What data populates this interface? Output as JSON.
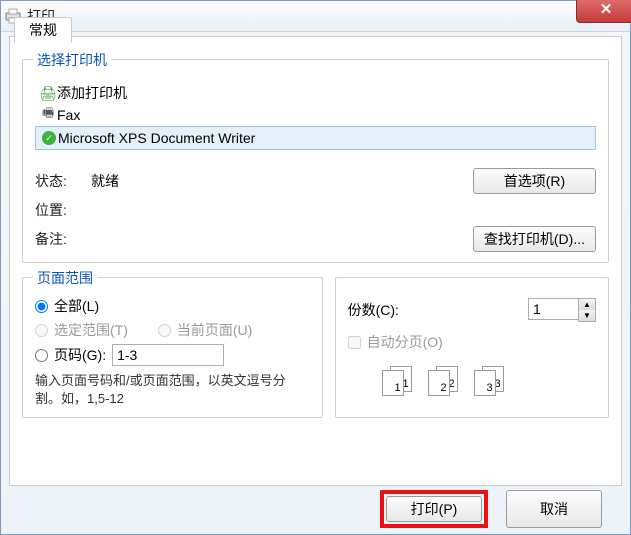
{
  "window": {
    "title": "打印"
  },
  "tab": {
    "general": "常规"
  },
  "printerGroup": {
    "legend": "选择打印机",
    "items": [
      {
        "label": "添加打印机",
        "icon": "add-printer"
      },
      {
        "label": "Fax",
        "icon": "fax"
      },
      {
        "label": "Microsoft XPS Document Writer",
        "icon": "xps",
        "selected": true
      }
    ],
    "status": {
      "label": "状态:",
      "value": "就绪"
    },
    "location": {
      "label": "位置:",
      "value": ""
    },
    "comment": {
      "label": "备注:",
      "value": ""
    },
    "prefsBtn": "首选项(R)",
    "findBtn": "查找打印机(D)..."
  },
  "rangeGroup": {
    "legend": "页面范围",
    "all": "全部(L)",
    "selection": "选定范围(T)",
    "current": "当前页面(U)",
    "pages": "页码(G):",
    "pagesValue": "1-3",
    "hint": "输入页面号码和/或页面范围，以英文逗号分割。如，1,5-12"
  },
  "copiesGroup": {
    "copiesLabel": "份数(C):",
    "copiesValue": "1",
    "collate": "自动分页(O)",
    "stacks": [
      "1",
      "2",
      "3"
    ]
  },
  "footer": {
    "print": "打印(P)",
    "cancel": "取消"
  }
}
